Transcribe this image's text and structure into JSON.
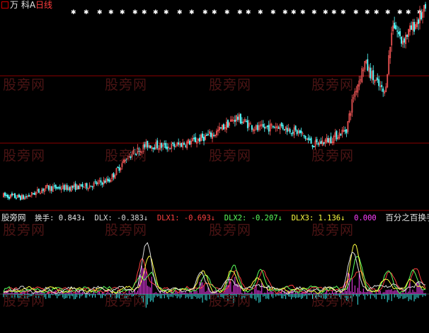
{
  "header": {
    "stock_name": "万  科A",
    "period": "日线"
  },
  "indicator": {
    "source": "股旁网",
    "items": [
      {
        "label": "换手: ",
        "value": "0.843↓",
        "color": "#e8e8e8"
      },
      {
        "label": "DLX: ",
        "value": "-0.383↓",
        "color": "#dcdcdc"
      },
      {
        "label": "DLX1: ",
        "value": "-0.693↓",
        "color": "#ff4040"
      },
      {
        "label": "DLX2: ",
        "value": "-0.207↓",
        "color": "#5cff5c"
      },
      {
        "label": "DLX3: ",
        "value": "1.136↓",
        "color": "#ffff40"
      },
      {
        "label": "",
        "value": "0.000",
        "color": "#ff40ff"
      }
    ],
    "suffix": "百分之百换手价:"
  },
  "watermark_text": "股旁网",
  "colors": {
    "up": "#ff5a5a",
    "down": "#54ffff",
    "grid": "#8b0000",
    "dlx1": "#ff4040",
    "dlx2": "#5cff5c",
    "dlx3": "#ffff40",
    "dlx": "#dcdcdc",
    "turnover_up": "#ff40ff",
    "turnover_down": "#40ffff"
  },
  "chart_data": [
    {
      "type": "candlestick",
      "title": "万  科A 日线",
      "x_count": 300,
      "grid": true,
      "trend_anchors": [
        [
          0,
          0.05
        ],
        [
          15,
          0.04
        ],
        [
          30,
          0.09
        ],
        [
          45,
          0.09
        ],
        [
          60,
          0.1
        ],
        [
          75,
          0.13
        ],
        [
          88,
          0.25
        ],
        [
          102,
          0.31
        ],
        [
          118,
          0.3
        ],
        [
          135,
          0.33
        ],
        [
          150,
          0.37
        ],
        [
          165,
          0.45
        ],
        [
          180,
          0.39
        ],
        [
          195,
          0.41
        ],
        [
          210,
          0.37
        ],
        [
          220,
          0.31
        ],
        [
          232,
          0.34
        ],
        [
          243,
          0.39
        ],
        [
          248,
          0.56
        ],
        [
          256,
          0.73
        ],
        [
          262,
          0.65
        ],
        [
          270,
          0.57
        ],
        [
          276,
          0.94
        ],
        [
          282,
          0.84
        ],
        [
          290,
          0.91
        ],
        [
          299,
          1.0
        ]
      ],
      "top_markers": "row of white star markers above the price series"
    },
    {
      "type": "line",
      "series": [
        {
          "name": "换手",
          "last": 0.843
        },
        {
          "name": "DLX",
          "last": -0.383
        },
        {
          "name": "DLX1",
          "last": -0.693
        },
        {
          "name": "DLX2",
          "last": -0.207
        },
        {
          "name": "DLX3",
          "last": 1.136
        }
      ],
      "spike_positions": [
        [
          100,
          1.0
        ],
        [
          140,
          0.45
        ],
        [
          162,
          0.55
        ],
        [
          182,
          0.45
        ],
        [
          248,
          0.95
        ],
        [
          272,
          0.45
        ],
        [
          291,
          0.5
        ]
      ]
    }
  ]
}
